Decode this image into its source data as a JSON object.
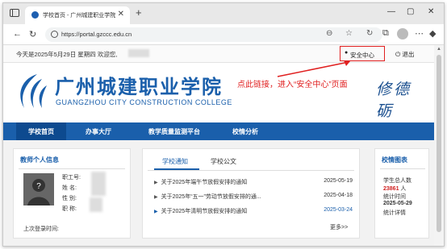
{
  "browser": {
    "tab_title": "学校首页 - 广州城建职业学院",
    "tab_close": "✕",
    "new_tab": "+",
    "url": "https://portal.gzccc.edu.cn",
    "window_controls": [
      "—",
      "▢",
      "✕"
    ]
  },
  "topbar": {
    "date_text": "今天是2025年5月29日 星期四   欢迎您,",
    "safety_center": "安全中心",
    "logout": "退出"
  },
  "banner": {
    "school_cn": "广州城建职业学院",
    "school_en": "GUANGZHOU CITY CONSTRUCTION COLLEGE",
    "motto": "修德 砺",
    "annotation": "点此链接，进入“安全中心”页面",
    "annotation_color": "#e02020"
  },
  "nav": {
    "items": [
      "学校首页",
      "办事大厅",
      "教学质量监测平台",
      "校情分析"
    ]
  },
  "teacher": {
    "title": "教师个人信息",
    "fields": [
      "职工号:",
      "姓    名:",
      "性    别:",
      "职    称:"
    ],
    "last_login": "上次登录时间:"
  },
  "notices": {
    "tabs": [
      "学校通知",
      "学校公文"
    ],
    "rows": [
      {
        "title": "关于2025年端午节放假安排的通知",
        "date": "2025-05-19"
      },
      {
        "title": "关于2025年“五一”劳动节放假安排的通...",
        "date": "2025-04-18"
      },
      {
        "title": "关于2025年清明节放假安排的通知",
        "date": "2025-03-24"
      }
    ],
    "more": "更多>>"
  },
  "stats": {
    "title": "校情图表",
    "total_label": "学生总人数",
    "total_value": "23861",
    "total_unit": "人",
    "detail_label": "统计时间",
    "date": "2025-05-29",
    "detail_link": "统计详情"
  },
  "colors": {
    "brand": "#1a5fab",
    "nav_bg": "#1a5fab",
    "highlight": "#e02020"
  }
}
